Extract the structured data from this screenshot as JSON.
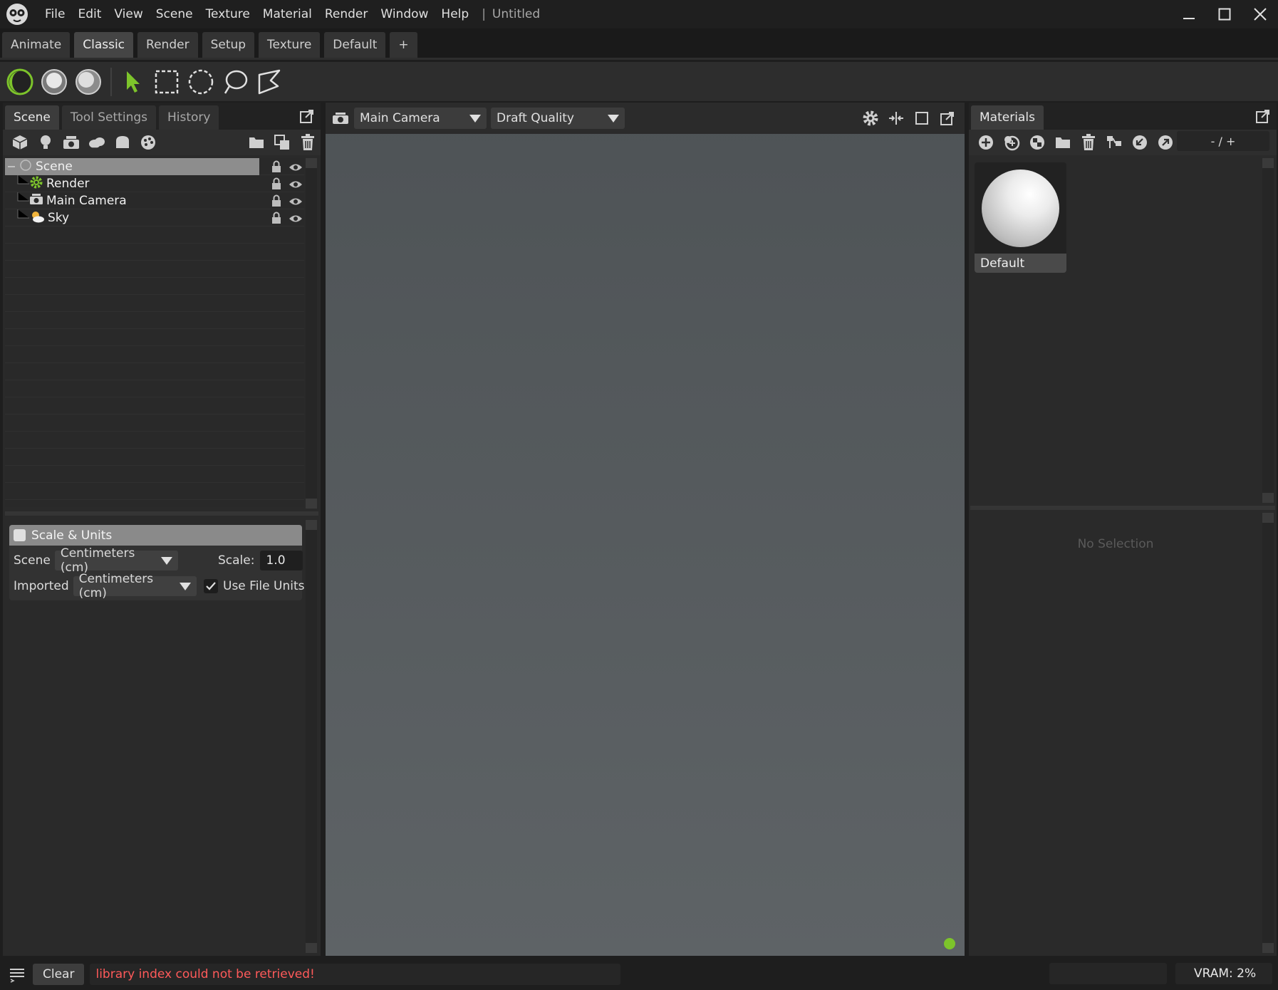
{
  "app": {
    "menu": [
      "File",
      "Edit",
      "View",
      "Scene",
      "Texture",
      "Material",
      "Render",
      "Window",
      "Help"
    ],
    "separator": "|",
    "doc_title": "Untitled"
  },
  "workspace_tabs": [
    {
      "label": "Animate",
      "active": false
    },
    {
      "label": "Classic",
      "active": true
    },
    {
      "label": "Render",
      "active": false
    },
    {
      "label": "Setup",
      "active": false
    },
    {
      "label": "Texture",
      "active": false
    },
    {
      "label": "Default",
      "active": false
    },
    {
      "label": "+",
      "active": false
    }
  ],
  "toolbar": {
    "icons": [
      "render-mode-icon",
      "matcap-mode-icon",
      "preview-mode-icon",
      "select-arrow-icon",
      "rect-select-icon",
      "circle-select-icon",
      "lasso-select-icon",
      "polygon-select-icon"
    ]
  },
  "left_panel": {
    "tabs": [
      "Scene",
      "Tool Settings",
      "History"
    ],
    "tree": [
      {
        "label": "Scene",
        "icon": "scene-root-icon",
        "selected": true
      },
      {
        "label": "Render",
        "icon": "render-gear-icon",
        "selected": false
      },
      {
        "label": "Main Camera",
        "icon": "camera-icon",
        "selected": false
      },
      {
        "label": "Sky",
        "icon": "sky-icon",
        "selected": false
      }
    ],
    "scale_units": {
      "title": "Scale & Units",
      "scene_label": "Scene",
      "scene_value": "Centimeters (cm)",
      "scale_label": "Scale:",
      "scale_value": "1.0",
      "imported_label": "Imported",
      "imported_value": "Centimeters (cm)",
      "use_file_units_label": "Use File Units",
      "use_file_units_checked": true
    }
  },
  "viewport": {
    "camera": "Main Camera",
    "quality": "Draft Quality",
    "status_color": "#7dc42b"
  },
  "materials": {
    "tab": "Materials",
    "search": "- / +",
    "items": [
      {
        "label": "Default"
      }
    ],
    "no_selection": "No Selection"
  },
  "statusbar": {
    "clear_label": "Clear",
    "message": "library index could not be retrieved!",
    "message_color": "#ff5a5a",
    "vram": "VRAM: 2%"
  }
}
